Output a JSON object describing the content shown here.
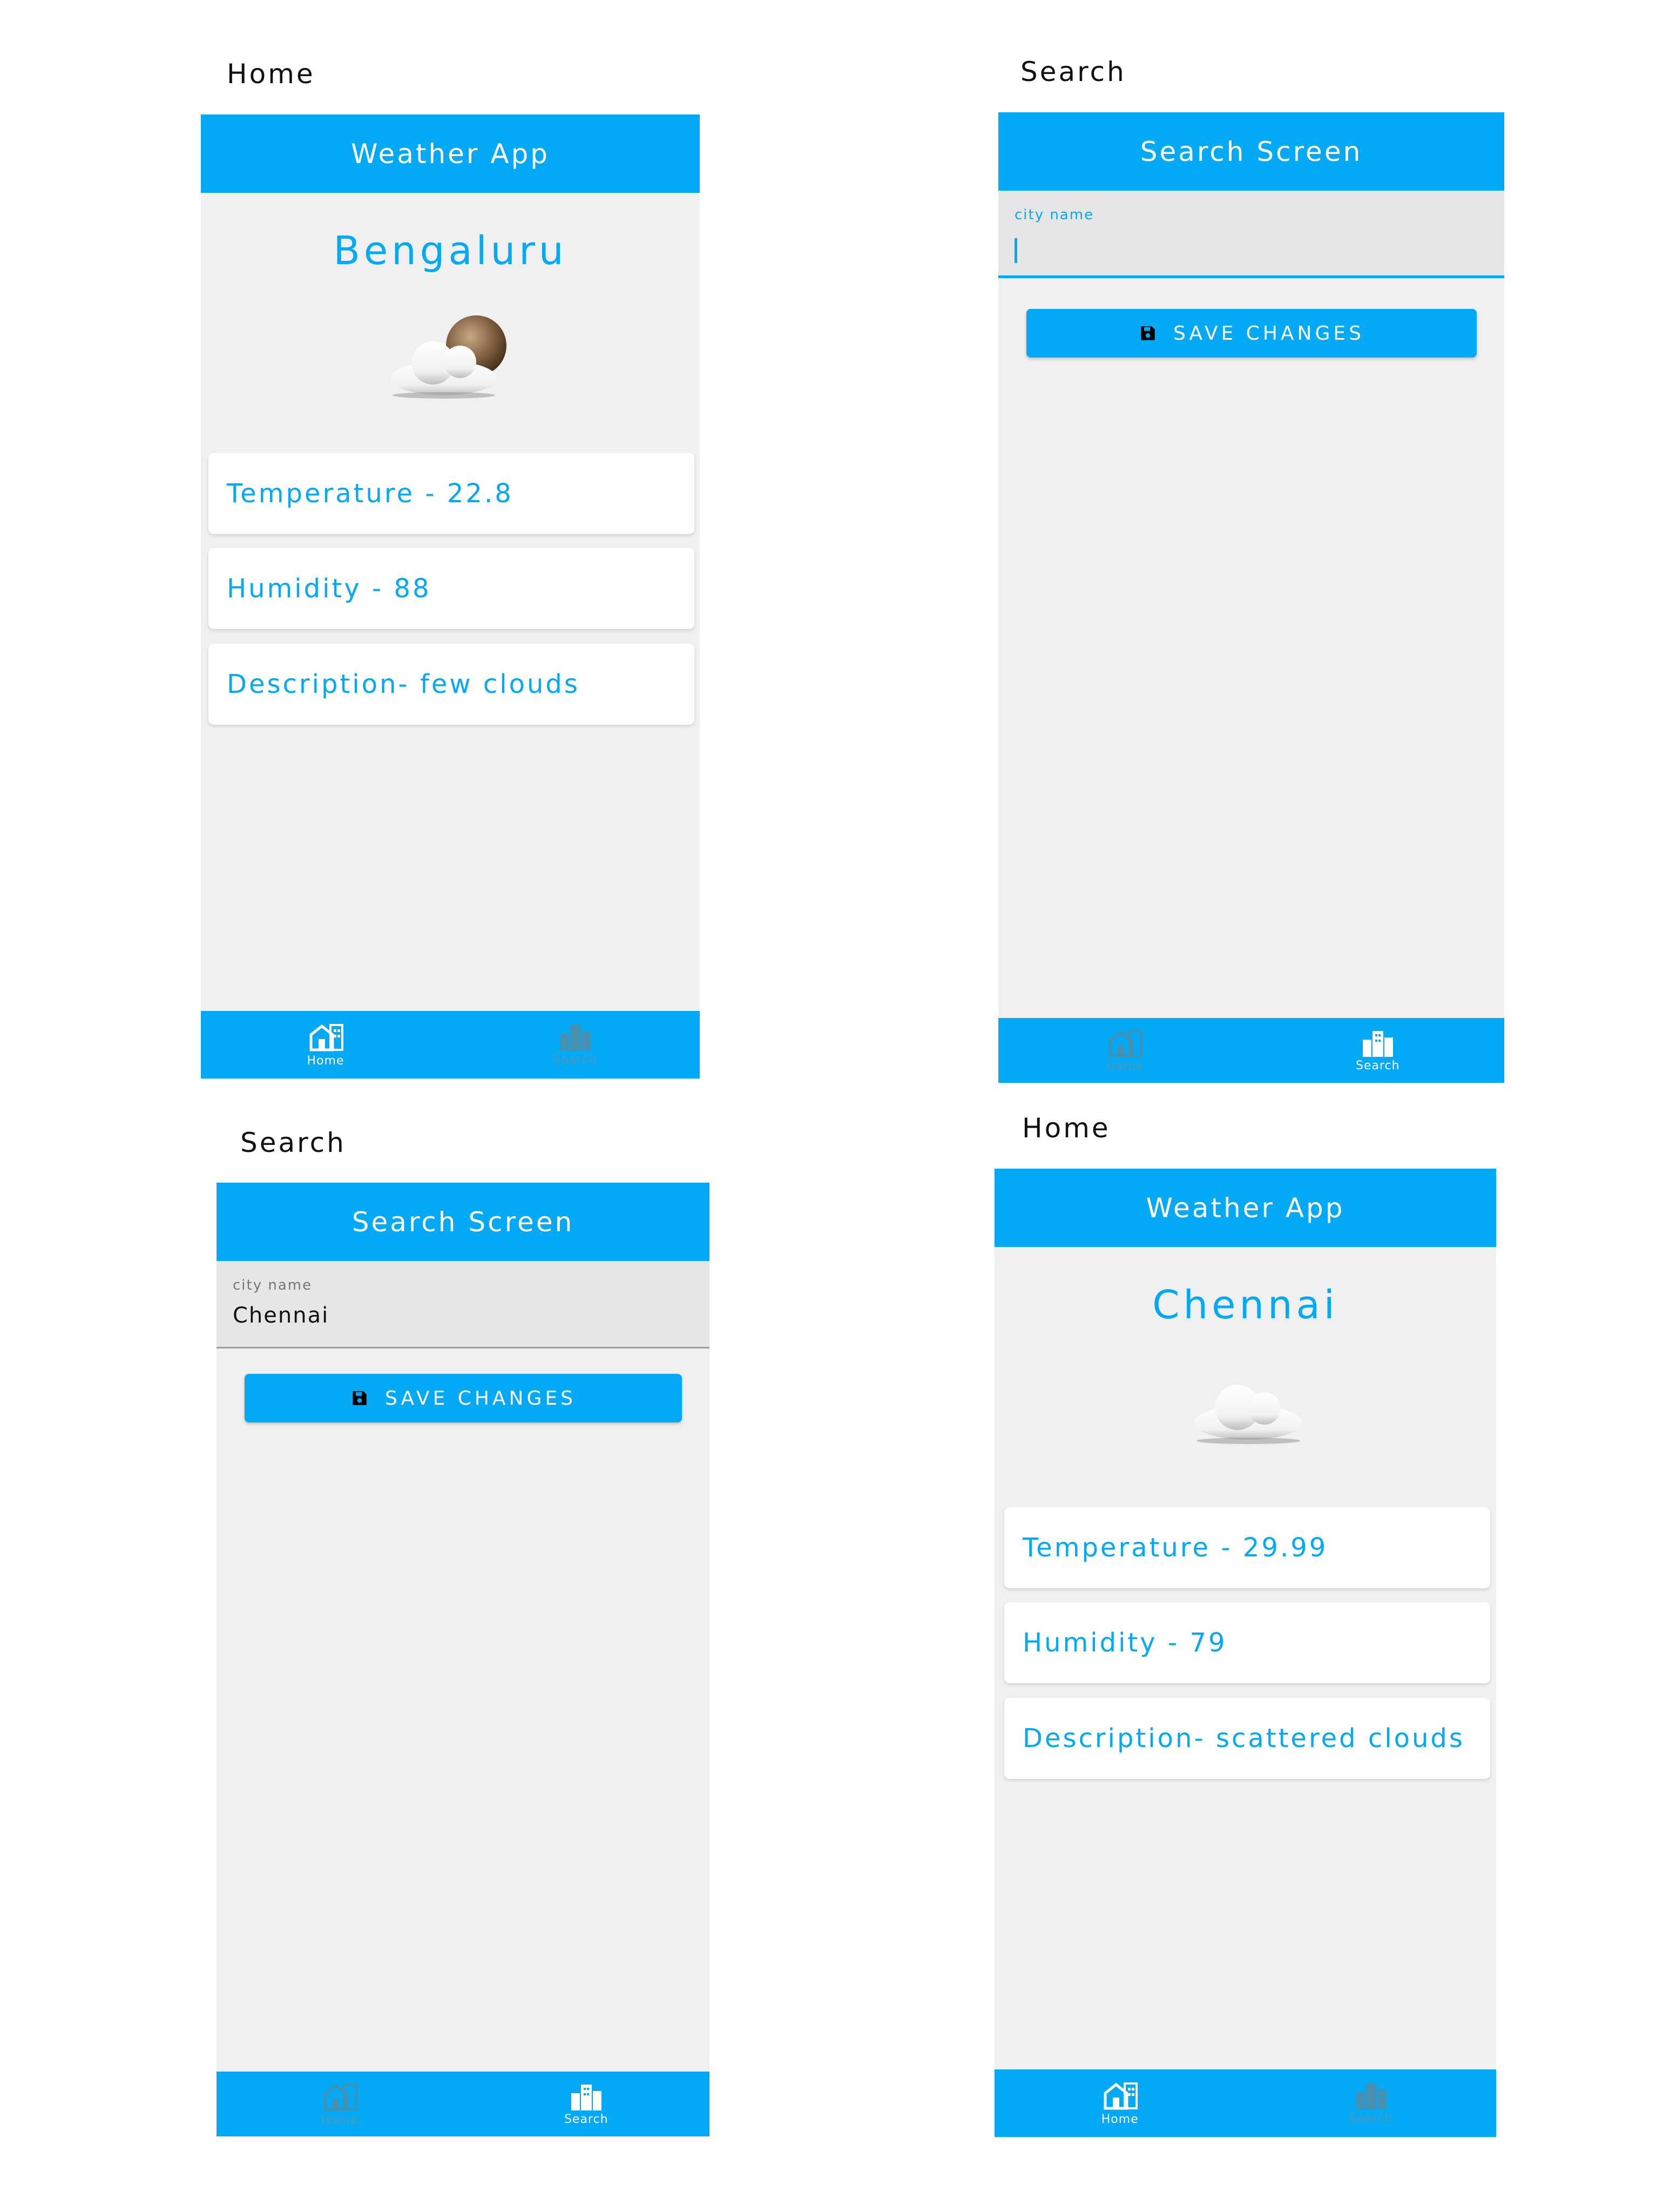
{
  "panels": [
    {
      "caption": "Home",
      "title": "Weather App",
      "city": "Bengaluru",
      "icon": "cloud-with-sun-icon",
      "cards": [
        "Temperature - 22.8",
        "Humidity - 88",
        "Description-  few clouds"
      ],
      "nav": {
        "home": "Home",
        "search": "Search",
        "active": "home"
      }
    },
    {
      "caption": "Search",
      "title": "Search Screen",
      "field_label": "city name",
      "field_value": "",
      "save_label": "SAVE CHANGES",
      "nav": {
        "home": "Home",
        "search": "Search",
        "active": "search"
      }
    },
    {
      "caption": "Search",
      "title": "Search Screen",
      "field_label": "city name",
      "field_value": "Chennai",
      "save_label": "SAVE CHANGES",
      "nav": {
        "home": "Home",
        "search": "Search",
        "active": "search"
      }
    },
    {
      "caption": "Home",
      "title": "Weather App",
      "city": "Chennai",
      "icon": "cloud-icon",
      "cards": [
        "Temperature - 29.99",
        "Humidity - 79",
        "Description-  scattered clouds"
      ],
      "nav": {
        "home": "Home",
        "search": "Search",
        "active": "home"
      }
    }
  ],
  "colors": {
    "accent": "#03a9f4",
    "background": "#f0f0f0",
    "field": "#e6e6e6"
  }
}
